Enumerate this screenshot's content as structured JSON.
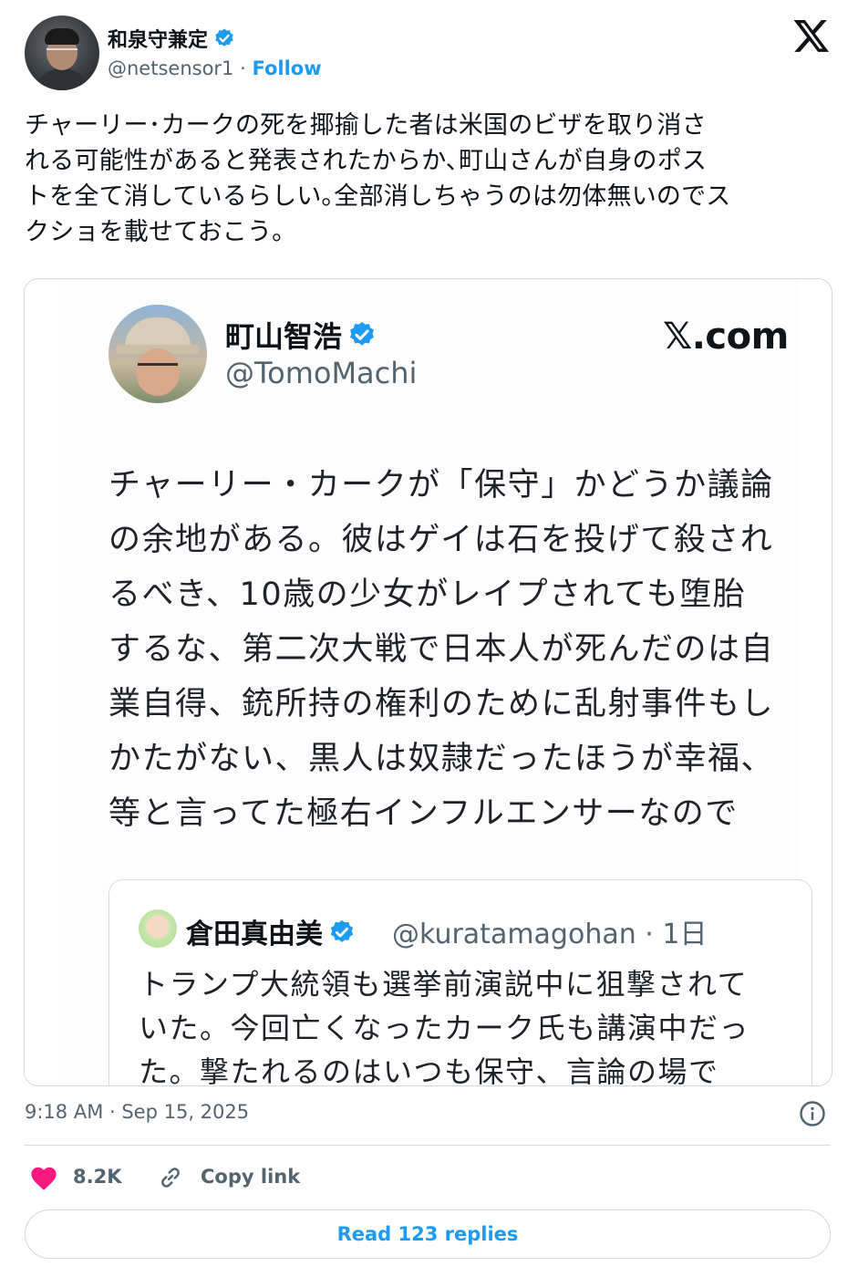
{
  "author": {
    "display_name": "和泉守兼定",
    "handle": "@netsensor1",
    "separator": " · ",
    "follow_label": "Follow"
  },
  "tweet": {
    "text": "チャーリー･カークの死を揶揄した者は米国のビザを取り消さ\nれる可能性があると発表されたからか､町山さんが自身のポス\nトを全て消しているらしい｡全部消しちゃうのは勿体無いのでス\nクショを載せておこう｡",
    "timestamp": "9:18 AM · Sep 15, 2025"
  },
  "screenshot": {
    "name": "町山智浩",
    "handle": "@TomoMachi",
    "site": "𝕏.com",
    "text": "チャーリー・カークが「保守」かどうか議論\nの余地がある。彼はゲイは石を投げて殺され\nるべき、10歳の少女がレイプされても堕胎\nするな、第二次大戦で日本人が死んだのは自\n業自得、銃所持の権利のために乱射事件もし\nかたがない、黒人は奴隷だったほうが幸福、\n等と言ってた極右インフルエンサーなので",
    "quote": {
      "name": "倉田真由美",
      "handle": "@kuratamagohan · 1日",
      "text": "トランプ大統領も選挙前演説中に狙撃されて\nいた。今回亡くなったカーク氏も講演中だっ\nた。撃たれるのはいつも保守、言論の場で"
    }
  },
  "actions": {
    "like_count": "8.2K",
    "copy_link_label": "Copy link",
    "read_replies_label": "Read 123 replies"
  },
  "icons": {
    "verified": "verified-badge-icon",
    "x_logo": "x-logo-icon",
    "info": "info-icon",
    "like": "heart-icon",
    "copy": "link-icon"
  },
  "colors": {
    "accent": "#1d9bf0",
    "like": "#f91880",
    "muted": "#536471",
    "border": "#cfd9de"
  }
}
